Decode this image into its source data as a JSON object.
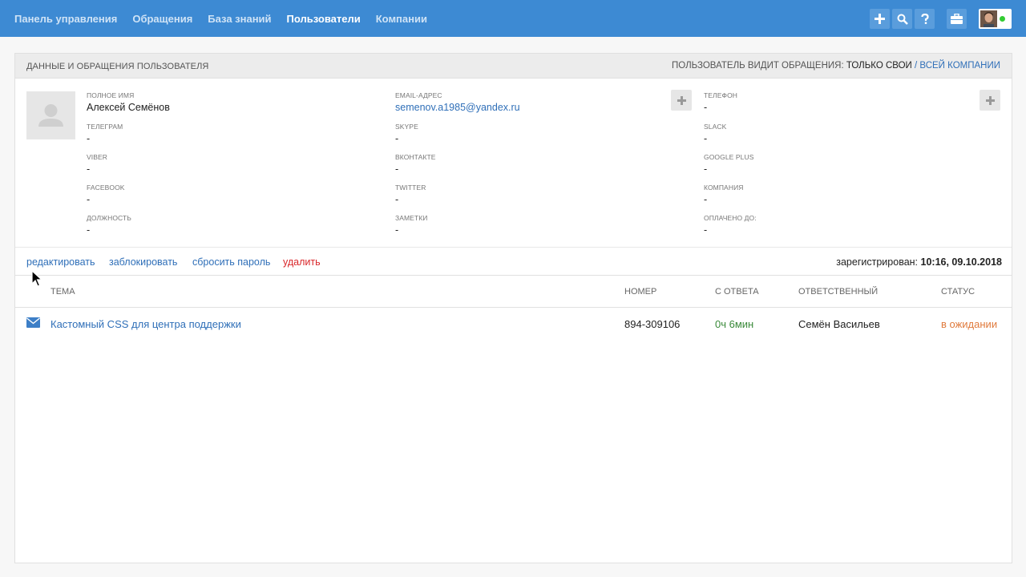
{
  "nav": {
    "items": [
      {
        "label": "Панель управления"
      },
      {
        "label": "Обращения"
      },
      {
        "label": "База знаний"
      },
      {
        "label": "Пользователи",
        "active": true
      },
      {
        "label": "Компании"
      }
    ]
  },
  "header_icons": [
    "plus-icon",
    "search-icon",
    "help-icon",
    "briefcase-icon",
    "avatar"
  ],
  "card": {
    "title": "Данные и обращения пользователя",
    "visibility_label": "Пользователь видит обращения:",
    "visibility_current": "только свои",
    "visibility_separator": "/",
    "visibility_alt": "всей компании"
  },
  "fields": {
    "full_name": {
      "label": "Полное имя",
      "value": "Алексей Семёнов"
    },
    "email": {
      "label": "Email-адрес",
      "value": "semenov.a1985@yandex.ru"
    },
    "phone": {
      "label": "Телефон",
      "value": "-"
    },
    "telegram": {
      "label": "Телеграм",
      "value": "-"
    },
    "skype": {
      "label": "Skype",
      "value": "-"
    },
    "slack": {
      "label": "Slack",
      "value": "-"
    },
    "viber": {
      "label": "Viber",
      "value": "-"
    },
    "vkontakte": {
      "label": "Вконтакте",
      "value": "-"
    },
    "google_plus": {
      "label": "Google Plus",
      "value": "-"
    },
    "facebook": {
      "label": "Facebook",
      "value": "-"
    },
    "twitter": {
      "label": "Twitter",
      "value": "-"
    },
    "company": {
      "label": "Компания",
      "value": "-"
    },
    "position": {
      "label": "Должность",
      "value": "-"
    },
    "notes": {
      "label": "Заметки",
      "value": "-"
    },
    "paid_until": {
      "label": "Оплачено до:",
      "value": "-"
    }
  },
  "actions": {
    "edit": "редактировать",
    "block": "заблокировать",
    "reset_password": "сбросить пароль",
    "delete": "удалить",
    "registered_label": "зарегистрирован:",
    "registered_value": "10:16, 09.10.2018"
  },
  "table": {
    "columns": {
      "subject": "Тема",
      "number": "Номер",
      "since_reply": "С ответа",
      "assignee": "Ответственный",
      "status": "Статус"
    },
    "rows": [
      {
        "icon": "envelope-icon",
        "subject": "Кастомный CSS для центра поддержки",
        "number": "894-309106",
        "since_reply": "0ч 6мин",
        "assignee": "Семён Васильев",
        "status": "в ожидании"
      }
    ]
  },
  "colors": {
    "header": "#3d8ad3",
    "link": "#2f6fb8",
    "delete": "#d9262a",
    "time": "#3a8a3a",
    "status_pending": "#e07a3c"
  }
}
